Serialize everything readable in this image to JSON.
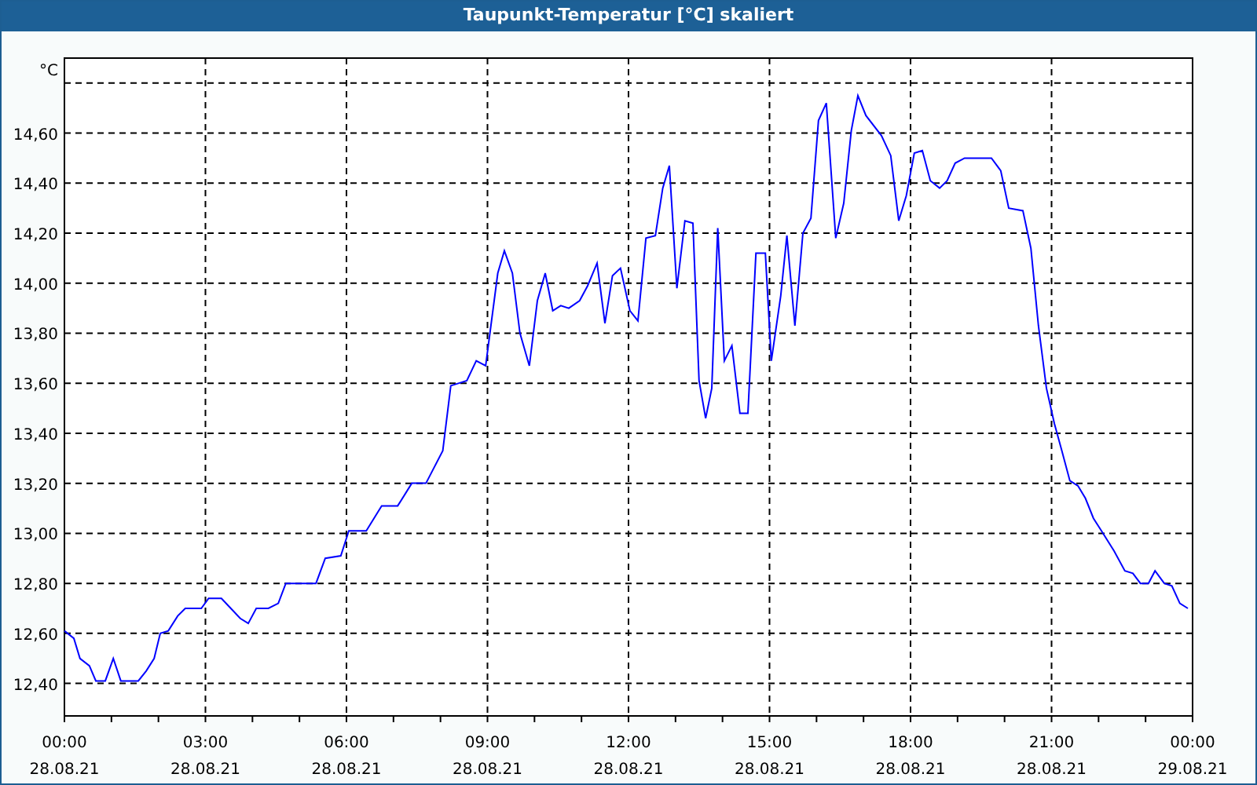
{
  "window": {
    "chart_data": {
      "type": "line",
      "title": "Taupunkt-Temperatur [°C] skaliert",
      "ylabel": "°C",
      "x": [
        0,
        0.2,
        0.33,
        0.53,
        0.67,
        0.87,
        1.04,
        1.2,
        1.4,
        1.57,
        1.74,
        1.91,
        2.04,
        2.21,
        2.41,
        2.57,
        2.91,
        3.07,
        3.34,
        3.54,
        3.74,
        3.91,
        4.08,
        4.34,
        4.55,
        4.71,
        5.35,
        5.55,
        5.88,
        6.05,
        6.42,
        6.75,
        7.09,
        7.39,
        7.69,
        8.05,
        8.22,
        8.56,
        8.76,
        8.96,
        9.22,
        9.36,
        9.53,
        9.69,
        9.89,
        10.06,
        10.23,
        10.39,
        10.56,
        10.73,
        10.96,
        11.13,
        11.33,
        11.5,
        11.66,
        11.83,
        12.03,
        12.2,
        12.37,
        12.57,
        12.73,
        12.87,
        13.03,
        13.2,
        13.37,
        13.5,
        13.64,
        13.77,
        13.9,
        14.04,
        14.2,
        14.37,
        14.54,
        14.71,
        14.91,
        15.04,
        15.24,
        15.37,
        15.54,
        15.71,
        15.88,
        16.04,
        16.21,
        16.41,
        16.58,
        16.74,
        16.88,
        17.05,
        17.38,
        17.58,
        17.75,
        17.91,
        18.08,
        18.25,
        18.42,
        18.62,
        18.78,
        18.95,
        19.15,
        19.72,
        19.92,
        20.09,
        20.39,
        20.56,
        20.72,
        20.89,
        21.06,
        21.22,
        21.39,
        21.56,
        21.72,
        21.89,
        22.06,
        22.33,
        22.56,
        22.73,
        22.89,
        23.06,
        23.2,
        23.4,
        23.56,
        23.73,
        23.9
      ],
      "series": [
        {
          "color": "#0000ff",
          "values": [
            12.61,
            12.58,
            12.5,
            12.47,
            12.41,
            12.41,
            12.5,
            12.41,
            12.41,
            12.41,
            12.45,
            12.5,
            12.6,
            12.61,
            12.67,
            12.7,
            12.7,
            12.74,
            12.74,
            12.7,
            12.66,
            12.64,
            12.7,
            12.7,
            12.72,
            12.8,
            12.8,
            12.9,
            12.91,
            13.01,
            13.01,
            13.11,
            13.11,
            13.2,
            13.2,
            13.33,
            13.59,
            13.61,
            13.69,
            13.67,
            14.04,
            14.13,
            14.04,
            13.8,
            13.67,
            13.93,
            14.04,
            13.89,
            13.91,
            13.9,
            13.93,
            13.99,
            14.08,
            13.84,
            14.03,
            14.06,
            13.89,
            13.85,
            14.18,
            14.19,
            14.38,
            14.47,
            13.98,
            14.25,
            14.24,
            13.61,
            13.46,
            13.58,
            14.22,
            13.69,
            13.75,
            13.48,
            13.48,
            14.12,
            14.12,
            13.69,
            13.95,
            14.19,
            13.83,
            14.2,
            14.26,
            14.65,
            14.72,
            14.18,
            14.32,
            14.61,
            14.75,
            14.67,
            14.59,
            14.51,
            14.25,
            14.35,
            14.52,
            14.53,
            14.41,
            14.38,
            14.41,
            14.48,
            14.5,
            14.5,
            14.45,
            14.3,
            14.29,
            14.14,
            13.83,
            13.58,
            13.44,
            13.33,
            13.21,
            13.19,
            13.14,
            13.06,
            13.01,
            12.93,
            12.85,
            12.84,
            12.8,
            12.8,
            12.85,
            12.8,
            12.79,
            12.72,
            12.7
          ]
        }
      ],
      "xlim": [
        0,
        24
      ],
      "ylim": [
        12.27,
        14.9
      ],
      "xticks": [
        {
          "value": 0,
          "label": "00:00"
        },
        {
          "value": 3,
          "label": "03:00"
        },
        {
          "value": 6,
          "label": "06:00"
        },
        {
          "value": 9,
          "label": "09:00"
        },
        {
          "value": 12,
          "label": "12:00"
        },
        {
          "value": 15,
          "label": "15:00"
        },
        {
          "value": 18,
          "label": "18:00"
        },
        {
          "value": 21,
          "label": "21:00"
        },
        {
          "value": 24,
          "label": "00:00"
        }
      ],
      "yticks": [
        {
          "value": 12.4,
          "label": "12,40"
        },
        {
          "value": 12.6,
          "label": "12,60"
        },
        {
          "value": 12.8,
          "label": "12,80"
        },
        {
          "value": 13.0,
          "label": "13,00"
        },
        {
          "value": 13.2,
          "label": "13,20"
        },
        {
          "value": 13.4,
          "label": "13,40"
        },
        {
          "value": 13.6,
          "label": "13,60"
        },
        {
          "value": 13.8,
          "label": "13,80"
        },
        {
          "value": 14.0,
          "label": "14,00"
        },
        {
          "value": 14.2,
          "label": "14,20"
        },
        {
          "value": 14.4,
          "label": "14,40"
        },
        {
          "value": 14.6,
          "label": "14,60"
        }
      ],
      "grid": true
    },
    "x_axis_dates": [
      "28.08.21",
      "28.08.21",
      "28.08.21",
      "28.08.21",
      "28.08.21",
      "28.08.21",
      "28.08.21",
      "28.08.21",
      "29.08.21"
    ]
  }
}
